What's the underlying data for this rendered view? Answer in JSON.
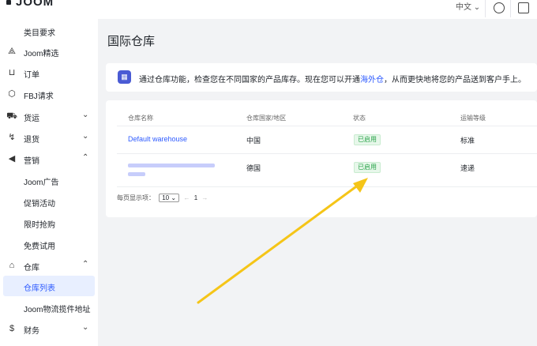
{
  "topbar": {
    "logo": "JOOM",
    "language": "中文 ⌄"
  },
  "sidebar": {
    "items": [
      {
        "label": "类目要求",
        "icon": "",
        "chevron": ""
      },
      {
        "label": "Joom精选",
        "icon": "tag-icon",
        "chevron": ""
      },
      {
        "label": "订单",
        "icon": "cart-icon",
        "chevron": ""
      },
      {
        "label": "FBJ请求",
        "icon": "box-icon",
        "chevron": ""
      },
      {
        "label": "货运",
        "icon": "truck-icon",
        "chevron": "⌄"
      },
      {
        "label": "退货",
        "icon": "return-icon",
        "chevron": "⌄"
      },
      {
        "label": "营销",
        "icon": "megaphone-icon",
        "chevron": "⌃"
      },
      {
        "label": "Joom广告",
        "icon": "",
        "chevron": ""
      },
      {
        "label": "促销活动",
        "icon": "",
        "chevron": ""
      },
      {
        "label": "限时抢购",
        "icon": "",
        "chevron": ""
      },
      {
        "label": "免费试用",
        "icon": "",
        "chevron": ""
      },
      {
        "label": "仓库",
        "icon": "warehouse-icon",
        "chevron": "⌃"
      },
      {
        "label": "仓库列表",
        "icon": "",
        "chevron": ""
      },
      {
        "label": "Joom物流揽件地址",
        "icon": "",
        "chevron": ""
      },
      {
        "label": "财务",
        "icon": "dollar-icon",
        "chevron": "⌄"
      }
    ]
  },
  "main": {
    "title": "国际仓库",
    "notice": {
      "text_before": "通过仓库功能，检查您在不同国家的产品库存。现在您可以开通",
      "link": "海外仓",
      "text_after": "，从而更快地将您的产品送到客户手上。"
    },
    "table": {
      "headers": [
        "仓库名称",
        "仓库国家/地区",
        "状态",
        "运输等级"
      ],
      "rows": [
        {
          "name": "Default warehouse",
          "country": "中国",
          "status": "已启用",
          "shipping": "标准"
        },
        {
          "name": "",
          "country": "德国",
          "status": "已启用",
          "shipping": "速递"
        }
      ]
    },
    "pager": {
      "label": "每页显示项：",
      "page_size": "10 ⌄",
      "prev": "←",
      "page": "1",
      "next": "→"
    }
  },
  "colors": {
    "accent": "#2e5bff",
    "success": "#2aa34a",
    "annotation_arrow": "#f5c518"
  }
}
